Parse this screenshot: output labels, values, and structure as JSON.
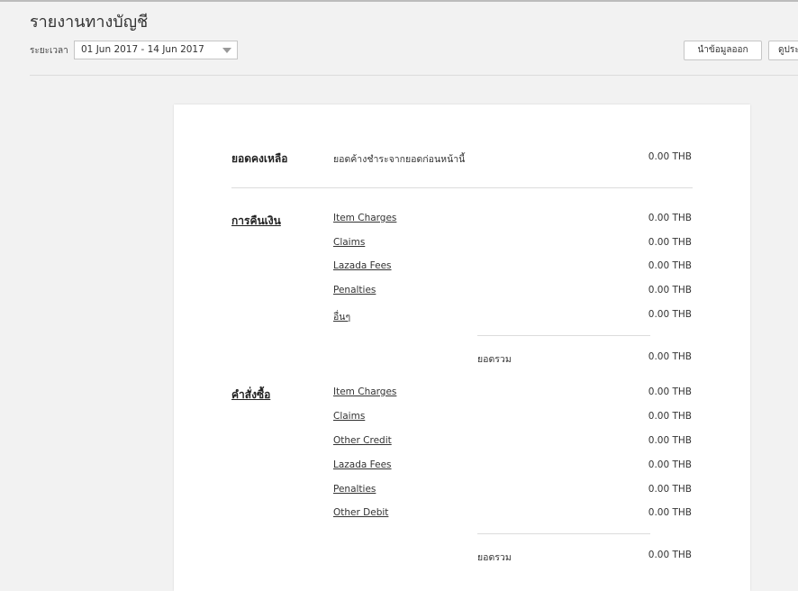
{
  "header": {
    "title": "รายงานทางบัญชี",
    "period_label": "ระยะเวลา",
    "date_range": "01 Jun 2017 - 14 Jun 2017",
    "export_label": "นำข้อมูลออก",
    "view_label": "ดูประ"
  },
  "balance": {
    "title": "ยอดคงเหลือ",
    "label": "ยอดค้างชำระจากยอดก่อนหน้านี้",
    "amount": "0.00 THB"
  },
  "refunds": {
    "title": "การคืนเงิน",
    "rows": [
      {
        "label": "Item Charges",
        "amount": "0.00 THB"
      },
      {
        "label": "Claims",
        "amount": "0.00 THB"
      },
      {
        "label": "Lazada Fees",
        "amount": "0.00 THB"
      },
      {
        "label": "Penalties",
        "amount": "0.00 THB"
      },
      {
        "label": "อื่นๆ",
        "amount": "0.00 THB"
      }
    ],
    "total_label": "ยอดรวม",
    "total_amount": "0.00 THB"
  },
  "orders": {
    "title": "คำสั่งซื้อ",
    "rows": [
      {
        "label": "Item Charges",
        "amount": "0.00 THB"
      },
      {
        "label": "Claims",
        "amount": "0.00 THB"
      },
      {
        "label": "Other Credit",
        "amount": "0.00 THB"
      },
      {
        "label": "Lazada Fees",
        "amount": "0.00 THB"
      },
      {
        "label": "Penalties",
        "amount": "0.00 THB"
      },
      {
        "label": "Other Debit",
        "amount": "0.00 THB"
      }
    ],
    "total_label": "ยอดรวม",
    "total_amount": "0.00 THB"
  }
}
